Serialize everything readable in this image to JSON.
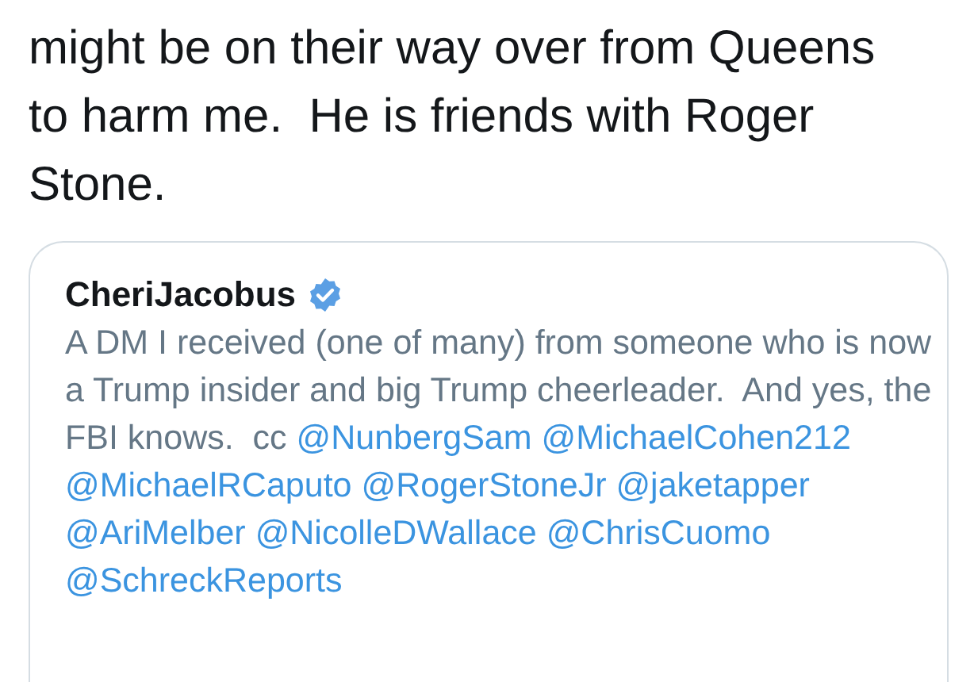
{
  "tweet": {
    "text": "might be on their way over from Queens to harm me.  He is friends with Roger Stone."
  },
  "quoted_tweet": {
    "author": "CheriJacobus",
    "verified": true,
    "body": [
      {
        "kind": "text",
        "text": "A DM I received (one of many) from someone who is now a Trump insider and big Trump cheerleader.  And yes, the FBI knows.  cc "
      },
      {
        "kind": "mention",
        "text": "@NunbergSam"
      },
      {
        "kind": "mention",
        "text": "@MichaelCohen212"
      },
      {
        "kind": "mention",
        "text": "@MichaelRCaputo"
      },
      {
        "kind": "mention",
        "text": "@RogerStoneJr"
      },
      {
        "kind": "mention",
        "text": "@jaketapper"
      },
      {
        "kind": "mention",
        "text": "@AriMelber"
      },
      {
        "kind": "mention",
        "text": "@NicolleDWallace"
      },
      {
        "kind": "mention",
        "text": "@ChrisCuomo"
      },
      {
        "kind": "mention",
        "text": "@SchreckReports"
      }
    ]
  }
}
